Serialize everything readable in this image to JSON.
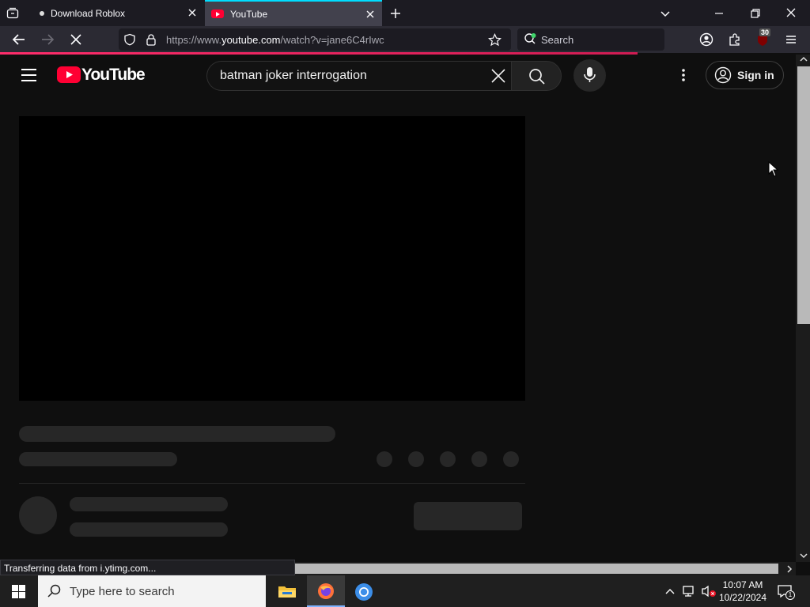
{
  "browser": {
    "tabs": [
      {
        "title": "Download Roblox",
        "active": false
      },
      {
        "title": "YouTube",
        "active": true
      }
    ],
    "url_prefix": "https://www.",
    "url_host": "youtube.com",
    "url_path": "/watch?v=jane6C4rIwc",
    "web_search_placeholder": "Search",
    "extension_badge": "30",
    "status_text": "Transferring data from i.ytimg.com..."
  },
  "youtube": {
    "logo_text": "YouTube",
    "search_value": "batman joker interrogation",
    "sign_in_label": "Sign in"
  },
  "taskbar": {
    "search_placeholder": "Type here to search",
    "time": "10:07 AM",
    "date": "10/22/2024",
    "notification_count": "1"
  },
  "colors": {
    "accent_tab": "#00ddff",
    "youtube_red": "#ff0033",
    "progress": "#ff2d6b"
  }
}
